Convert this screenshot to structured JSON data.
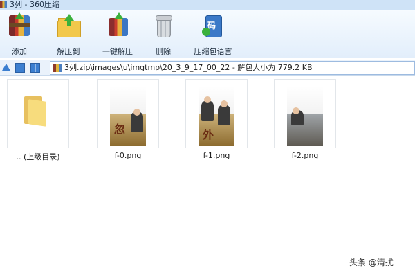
{
  "window": {
    "title": "3列 - 360压缩"
  },
  "toolbar": {
    "add": {
      "label": "添加",
      "icon": "add-archive-icon"
    },
    "extract_to": {
      "label": "解压到",
      "icon": "extract-folder-icon"
    },
    "one_click_extract": {
      "label": "一键解压",
      "icon": "one-click-extract-icon"
    },
    "delete": {
      "label": "删除",
      "icon": "trash-icon"
    },
    "language": {
      "label": "压缩包语言",
      "icon": "language-book-icon"
    }
  },
  "addressbar": {
    "path": "3列.zip\\images\\u\\imgtmp\\20_3_9_17_00_22 - 解包大小为 779.2 KB"
  },
  "files": [
    {
      "name": ".. (上级目录)",
      "type": "folder"
    },
    {
      "name": "f-0.png",
      "type": "image"
    },
    {
      "name": "f-1.png",
      "type": "image"
    },
    {
      "name": "f-2.png",
      "type": "image"
    }
  ],
  "watermark": "头条 @清扰"
}
